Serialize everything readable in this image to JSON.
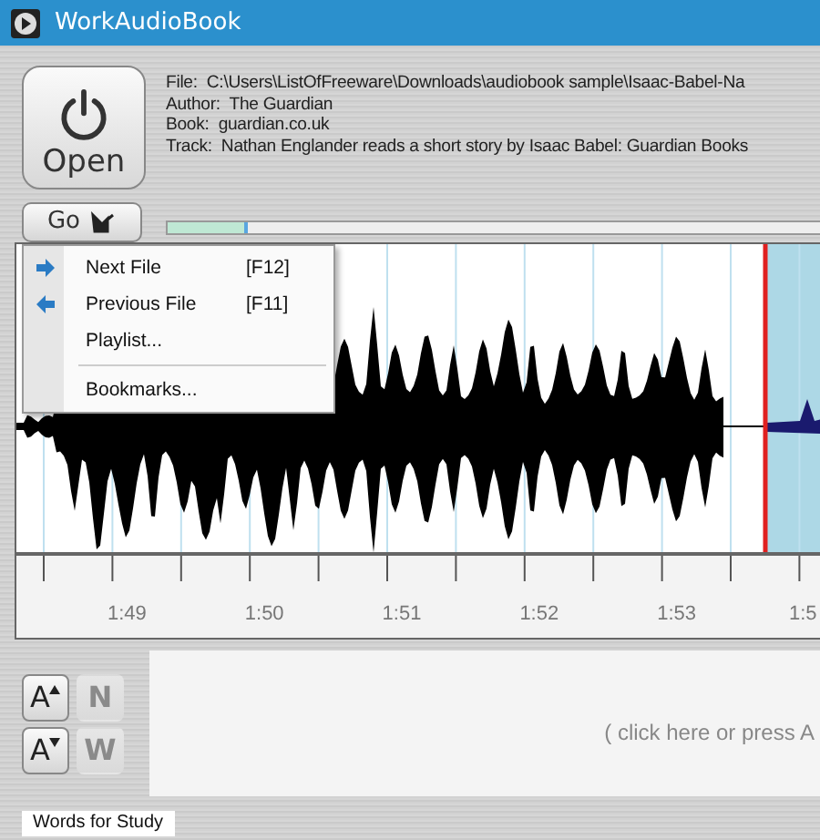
{
  "window": {
    "title": "WorkAudioBook"
  },
  "open_button": {
    "label": "Open"
  },
  "info": [
    {
      "label": "File:",
      "value": "C:\\Users\\ListOfFreeware\\Downloads\\audiobook sample\\Isaac-Babel-Na"
    },
    {
      "label": "Author:",
      "value": "The Guardian"
    },
    {
      "label": "Book:",
      "value": "guardian.co.uk"
    },
    {
      "label": "Track:",
      "value": "Nathan Englander reads a short story by Isaac Babel: Guardian Books"
    }
  ],
  "go_button": {
    "label": "Go"
  },
  "progress": {
    "level": 0.12
  },
  "go_menu": [
    {
      "kind": "next",
      "label": "Next File",
      "shortcut": "[F12]"
    },
    {
      "kind": "previous",
      "label": "Previous File",
      "shortcut": "[F11]"
    },
    {
      "kind": "plain",
      "label": "Playlist..."
    },
    {
      "kind": "separator"
    },
    {
      "kind": "plain",
      "label": "Bookmarks..."
    }
  ],
  "ruler_labels": [
    "1:49",
    "1:50",
    "1:51",
    "1:52",
    "1:53",
    "1:5"
  ],
  "font_buttons": [
    {
      "kind": "grow",
      "label": "A",
      "disabled": false
    },
    {
      "kind": "new",
      "label": "N",
      "disabled": true
    },
    {
      "kind": "shrink",
      "label": "A",
      "disabled": false
    },
    {
      "kind": "new",
      "label": "W",
      "disabled": true
    }
  ],
  "text_area": {
    "placeholder": "( click here or press A"
  },
  "tabs": [
    {
      "label": "Words for Study",
      "selected": true
    }
  ]
}
